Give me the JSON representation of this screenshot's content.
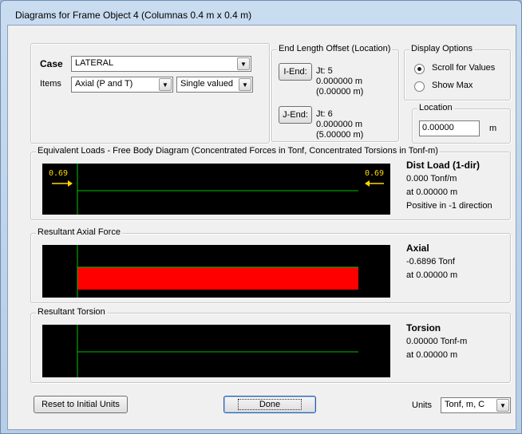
{
  "window": {
    "title": "Diagrams for Frame Object 4  (Columnas 0.4 m x 0.4 m)"
  },
  "case": {
    "label": "Case",
    "value": "LATERAL",
    "items_label": "Items",
    "items_value": "Axial (P and T)",
    "mode_value": "Single valued"
  },
  "end_offset": {
    "legend": "End Length Offset (Location)",
    "i_end": {
      "button": "I-End:",
      "jt": "Jt:  5",
      "offset": "0.000000 m",
      "location": "(0.00000 m)"
    },
    "j_end": {
      "button": "J-End:",
      "jt": "Jt:  6",
      "offset": "0.000000 m",
      "location": "(5.00000 m)"
    }
  },
  "display_options": {
    "legend": "Display Options",
    "options": [
      "Scroll for Values",
      "Show Max"
    ],
    "selected": "Scroll for Values"
  },
  "location": {
    "legend": "Location",
    "value": "0.00000",
    "unit": "m"
  },
  "fbd": {
    "legend": "Equivalent Loads - Free Body Diagram  (Concentrated Forces in Tonf, Concentrated Torsions in Tonf-m)",
    "left_load": "0.69",
    "right_load": "0.69",
    "info_title": "Dist Load (1-dir)",
    "info_value": "0.000 Tonf/m",
    "info_at": "at 0.00000 m",
    "info_dir": "Positive in -1 direction"
  },
  "axial": {
    "legend": "Resultant Axial Force",
    "info_title": "Axial",
    "info_value": "-0.6896 Tonf",
    "info_at": "at 0.00000 m",
    "fill_color": "#ff0000",
    "fraction_of_max": 1.0
  },
  "torsion": {
    "legend": "Resultant Torsion",
    "info_title": "Torsion",
    "info_value": "0.00000 Tonf-m",
    "info_at": "at 0.00000 m"
  },
  "footer": {
    "reset_button": "Reset to Initial Units",
    "done_button": "Done",
    "units_label": "Units",
    "units_value": "Tonf, m, C"
  },
  "colors": {
    "plot_bg": "#000000",
    "axis_line": "#00c000",
    "load_arrow": "#ffd700",
    "axial_fill": "#ff0000"
  },
  "icons": [
    "dropdown-arrow-icon",
    "load-arrow-right-icon",
    "load-arrow-left-icon"
  ]
}
